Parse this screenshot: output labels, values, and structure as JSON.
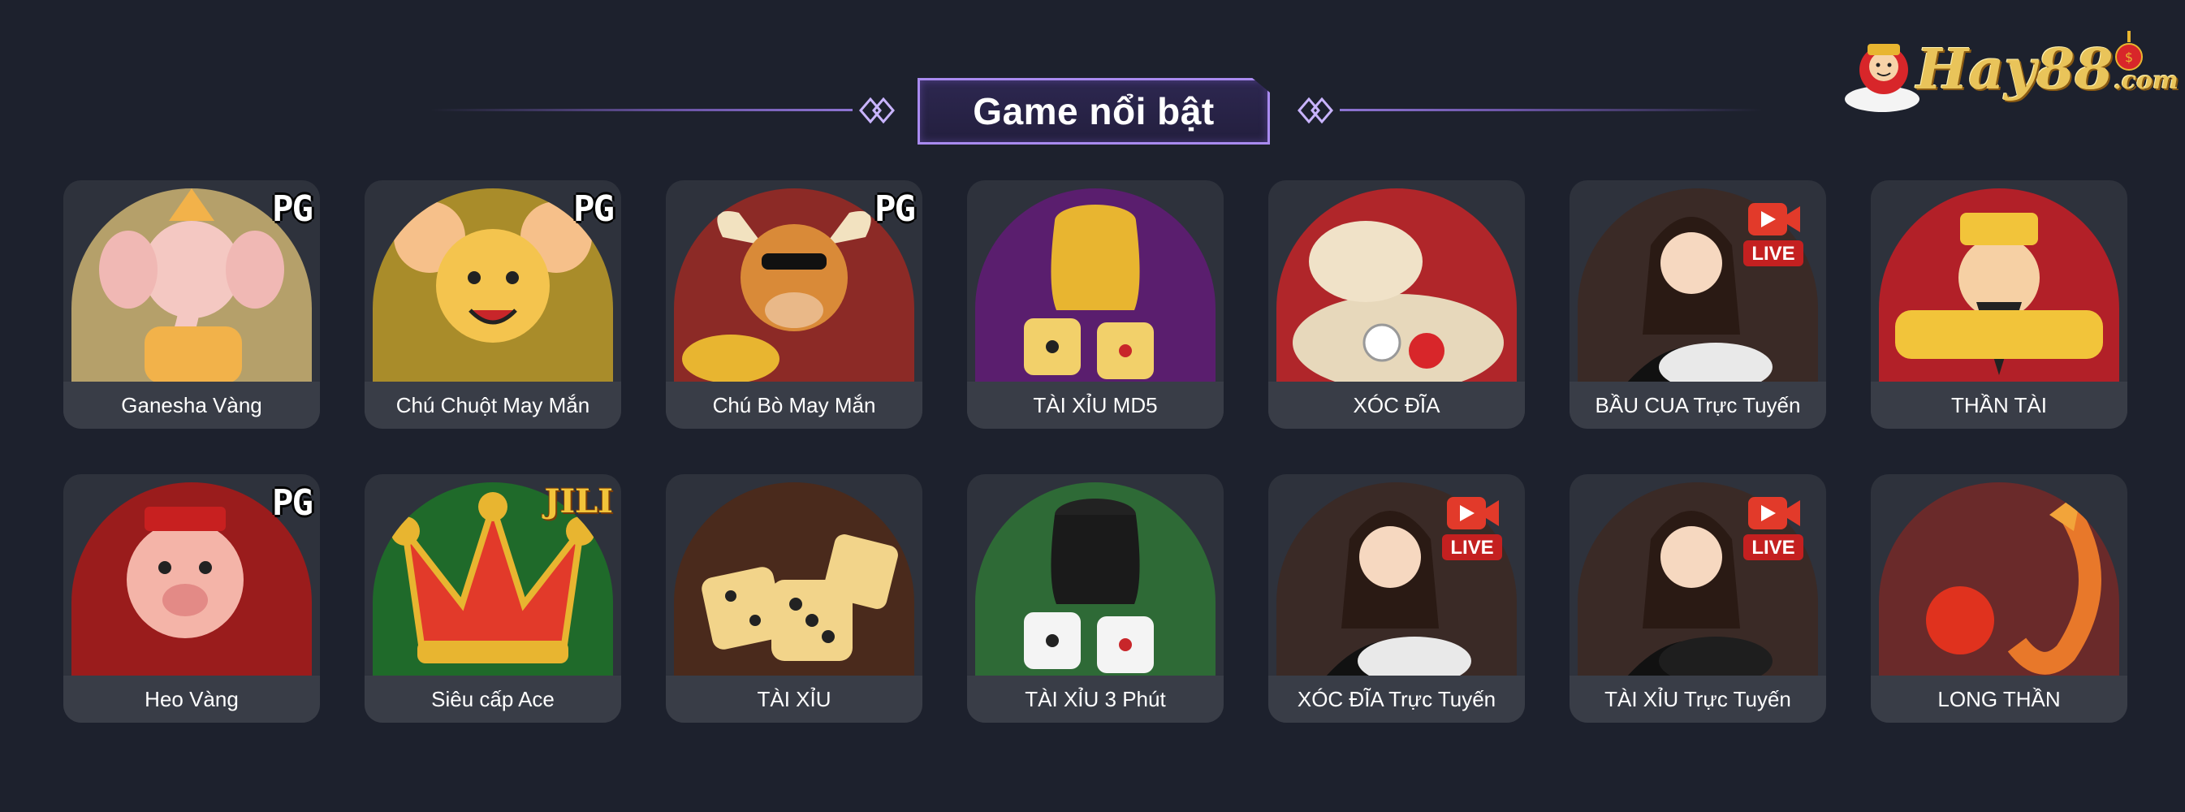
{
  "header": {
    "title": "Game nổi bật"
  },
  "logo": {
    "brand": "Hay88",
    "domain": ".com"
  },
  "games": [
    {
      "label": "Ganesha Vàng",
      "provider": "PG",
      "icon": "ganesha-icon",
      "bg": "#b5a06a",
      "accent": "#f2b24a"
    },
    {
      "label": "Chú Chuột May Mắn",
      "provider": "PG",
      "icon": "mouse-icon",
      "bg": "#a98c2a",
      "accent": "#f4c44e"
    },
    {
      "label": "Chú Bò May Mắn",
      "provider": "PG",
      "icon": "bull-icon",
      "bg": "#8c2a26",
      "accent": "#d98a38"
    },
    {
      "label": "TÀI XỈU MD5",
      "provider": "",
      "icon": "dice-cup-gold-icon",
      "bg": "#5a1e6e",
      "accent": "#e8b530"
    },
    {
      "label": "XÓC ĐĨA",
      "provider": "",
      "icon": "disc-bowl-icon",
      "bg": "#b0262a",
      "accent": "#f0e2c8"
    },
    {
      "label": "BẦU CUA Trực Tuyến",
      "provider": "LIVE",
      "icon": "live-dealer-icon",
      "bg": "#3a2a26",
      "accent": "#e9e9e9"
    },
    {
      "label": "THẦN TÀI",
      "provider": "",
      "icon": "god-of-wealth-icon",
      "bg": "#b22028",
      "accent": "#f2c43a"
    },
    {
      "label": "Heo Vàng",
      "provider": "PG",
      "icon": "pig-icon",
      "bg": "#9a1c1c",
      "accent": "#f4b4a8"
    },
    {
      "label": "Siêu cấp Ace",
      "provider": "JILI",
      "icon": "jester-hat-icon",
      "bg": "#1f6a2a",
      "accent": "#e23a2a"
    },
    {
      "label": "TÀI XỈU",
      "provider": "",
      "icon": "dice-icon",
      "bg": "#4a2a1c",
      "accent": "#f2d48a"
    },
    {
      "label": "TÀI XỈU 3 Phút",
      "provider": "",
      "icon": "dice-cup-icon",
      "bg": "#2e6a36",
      "accent": "#f4f4f4"
    },
    {
      "label": "XÓC ĐĨA Trực Tuyến",
      "provider": "LIVE",
      "icon": "live-dealer-icon",
      "bg": "#3a2a26",
      "accent": "#e9e9e9"
    },
    {
      "label": "TÀI XỈU Trực Tuyến",
      "provider": "LIVE",
      "icon": "live-dealer-icon",
      "bg": "#3a2a26",
      "accent": "#1e1e1e"
    },
    {
      "label": "LONG THẦN",
      "provider": "",
      "icon": "dragon-icon",
      "bg": "#6a2a2a",
      "accent": "#e8782a"
    }
  ],
  "colors": {
    "page_bg": "#1d212d",
    "card_bg": "#2e323c",
    "label_bg": "#393d47",
    "title_border": "#a98bf0"
  }
}
